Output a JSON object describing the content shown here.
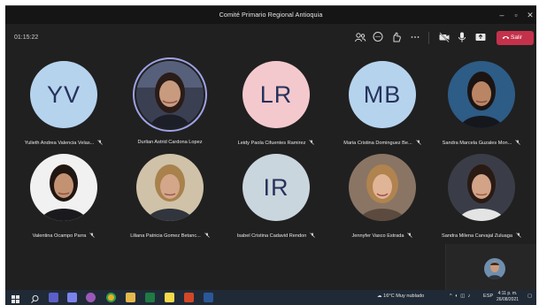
{
  "window": {
    "title": "Comité Primario Regional Antioquia",
    "controls": [
      "minimize-icon",
      "maximize-icon",
      "close-icon"
    ]
  },
  "toolbar": {
    "timer": "01:15:22",
    "icons": [
      "participants-icon",
      "chat-icon",
      "reactions-icon",
      "more-icon",
      "camera-off-icon",
      "microphone-icon",
      "share-icon"
    ],
    "leave_label": "Salir",
    "leave_color": "#c4314b"
  },
  "participants": [
    {
      "name": "Yulieth Andrea Valencia Velas...",
      "initials": "YV",
      "avatar": "initials",
      "bg": "#b6d3ee"
    },
    {
      "name": "Durlian Astrid Cardona Lopez",
      "avatar": "photo",
      "speaking": true
    },
    {
      "name": "Leidy Paola Cifuentes Ramirez",
      "initials": "LR",
      "avatar": "initials",
      "bg": "#f4c9cd"
    },
    {
      "name": "Maria Cristina Dominguez Be...",
      "initials": "MB",
      "avatar": "initials",
      "bg": "#b6d3ee"
    },
    {
      "name": "Sandra Marcela Guzales Mon...",
      "avatar": "photo"
    },
    {
      "name": "Valentina Ocampo Parra",
      "avatar": "photo"
    },
    {
      "name": "Liliana Patricia Gomez Betanc...",
      "avatar": "photo"
    },
    {
      "name": "Isabel Cristina Cadavid Rendon",
      "initials": "IR",
      "avatar": "initials",
      "bg": "#c9d6dd"
    },
    {
      "name": "Jennyfer Vasco Estrada",
      "avatar": "photo"
    },
    {
      "name": "Sandra Milena Carvajal Zuluaga",
      "avatar": "photo"
    }
  ],
  "taskbar": {
    "apps": [
      "windows-start-icon",
      "search-icon",
      "teams-icon",
      "teams-alt-icon",
      "app-icon",
      "chrome-icon",
      "file-explorer-icon",
      "excel-icon",
      "sticky-notes-icon",
      "powerpoint-icon",
      "word-icon"
    ],
    "weather": "16°C  Muy nublado",
    "language": "ESP",
    "time": "4:11 p. m.",
    "date": "26/08/2021"
  }
}
